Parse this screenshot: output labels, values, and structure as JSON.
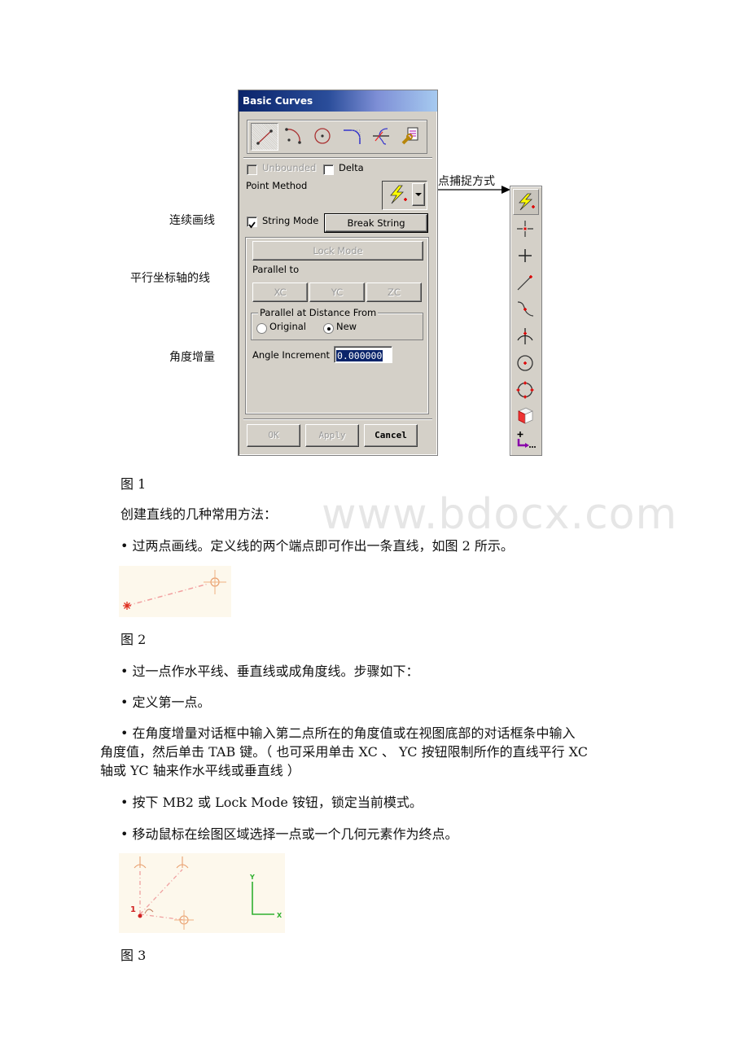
{
  "annotations": {
    "string_mode": "连续画线",
    "parallel_axis": "平行坐标轴的线",
    "angle_increment": "角度增量",
    "snap_method": "点捕捉方式"
  },
  "dialog": {
    "title": "Basic Curves",
    "curve_tools": [
      {
        "icon": "line-icon",
        "active": true
      },
      {
        "icon": "arc-icon",
        "active": false
      },
      {
        "icon": "circle-icon",
        "active": false
      },
      {
        "icon": "fillet-icon",
        "active": false
      },
      {
        "icon": "trim-icon",
        "active": false
      },
      {
        "icon": "edit-curve-parameters-icon",
        "active": false
      }
    ],
    "unbounded_label": "Unbounded",
    "unbounded_checked": false,
    "delta_label": "Delta",
    "delta_checked": false,
    "point_method_label": "Point Method",
    "string_mode_label": "String Mode",
    "string_mode_checked": true,
    "break_string_label": "Break String",
    "lock_mode_label": "Lock Mode",
    "parallel_to_label": "Parallel to",
    "axis_buttons": [
      "XC",
      "YC",
      "ZC"
    ],
    "parallel_distance_group": "Parallel at Distance From",
    "radio_original": "Original",
    "radio_new": "New",
    "selected_radio": "New",
    "angle_increment_label": "Angle Increment",
    "angle_increment_value": "0.000000",
    "ok_label": "OK",
    "apply_label": "Apply",
    "cancel_label": "Cancel"
  },
  "snap_toolbar": {
    "items": [
      "inferred-point-icon",
      "cursor-location-icon",
      "existing-point-icon",
      "end-point-icon",
      "control-point-icon",
      "intersection-point-icon",
      "arc-center-icon",
      "quadrant-point-icon",
      "point-on-face-icon",
      "point-constructor-icon"
    ]
  },
  "document": {
    "fig1_caption": "图 1",
    "intro": "创建直线的几种常用方法：",
    "bullet1": "•  过两点画线。定义线的两个端点即可作出一条直线，如图 2 所示。",
    "fig2_caption": "图 2",
    "bullet2": "•  过一点作水平线、垂直线或成角度线。步骤如下：",
    "bullet3": "•  定义第一点。",
    "bullet4_line1": "•  在角度增量对话框中输入第二点所在的角度值或在视图底部的对话框条中输入",
    "bullet4_line2": "角度值，然后单击 TAB 键。（ 也可采用单击 XC 、 YC 按钮限制所作的直线平行 XC",
    "bullet4_line3": "轴或 YC 轴来作水平线或垂直线 ）",
    "bullet5": "•  按下 MB2 或 Lock Mode 铵钮，锁定当前模式。",
    "bullet6": "•  移动鼠标在绘图区域选择一点或一个几何元素作为终点。",
    "fig3_caption": "图 3",
    "fig3_point_label": "1",
    "fig3_axis_y": "Y",
    "fig3_axis_x": "X",
    "watermark": "www.bdocx.com"
  }
}
